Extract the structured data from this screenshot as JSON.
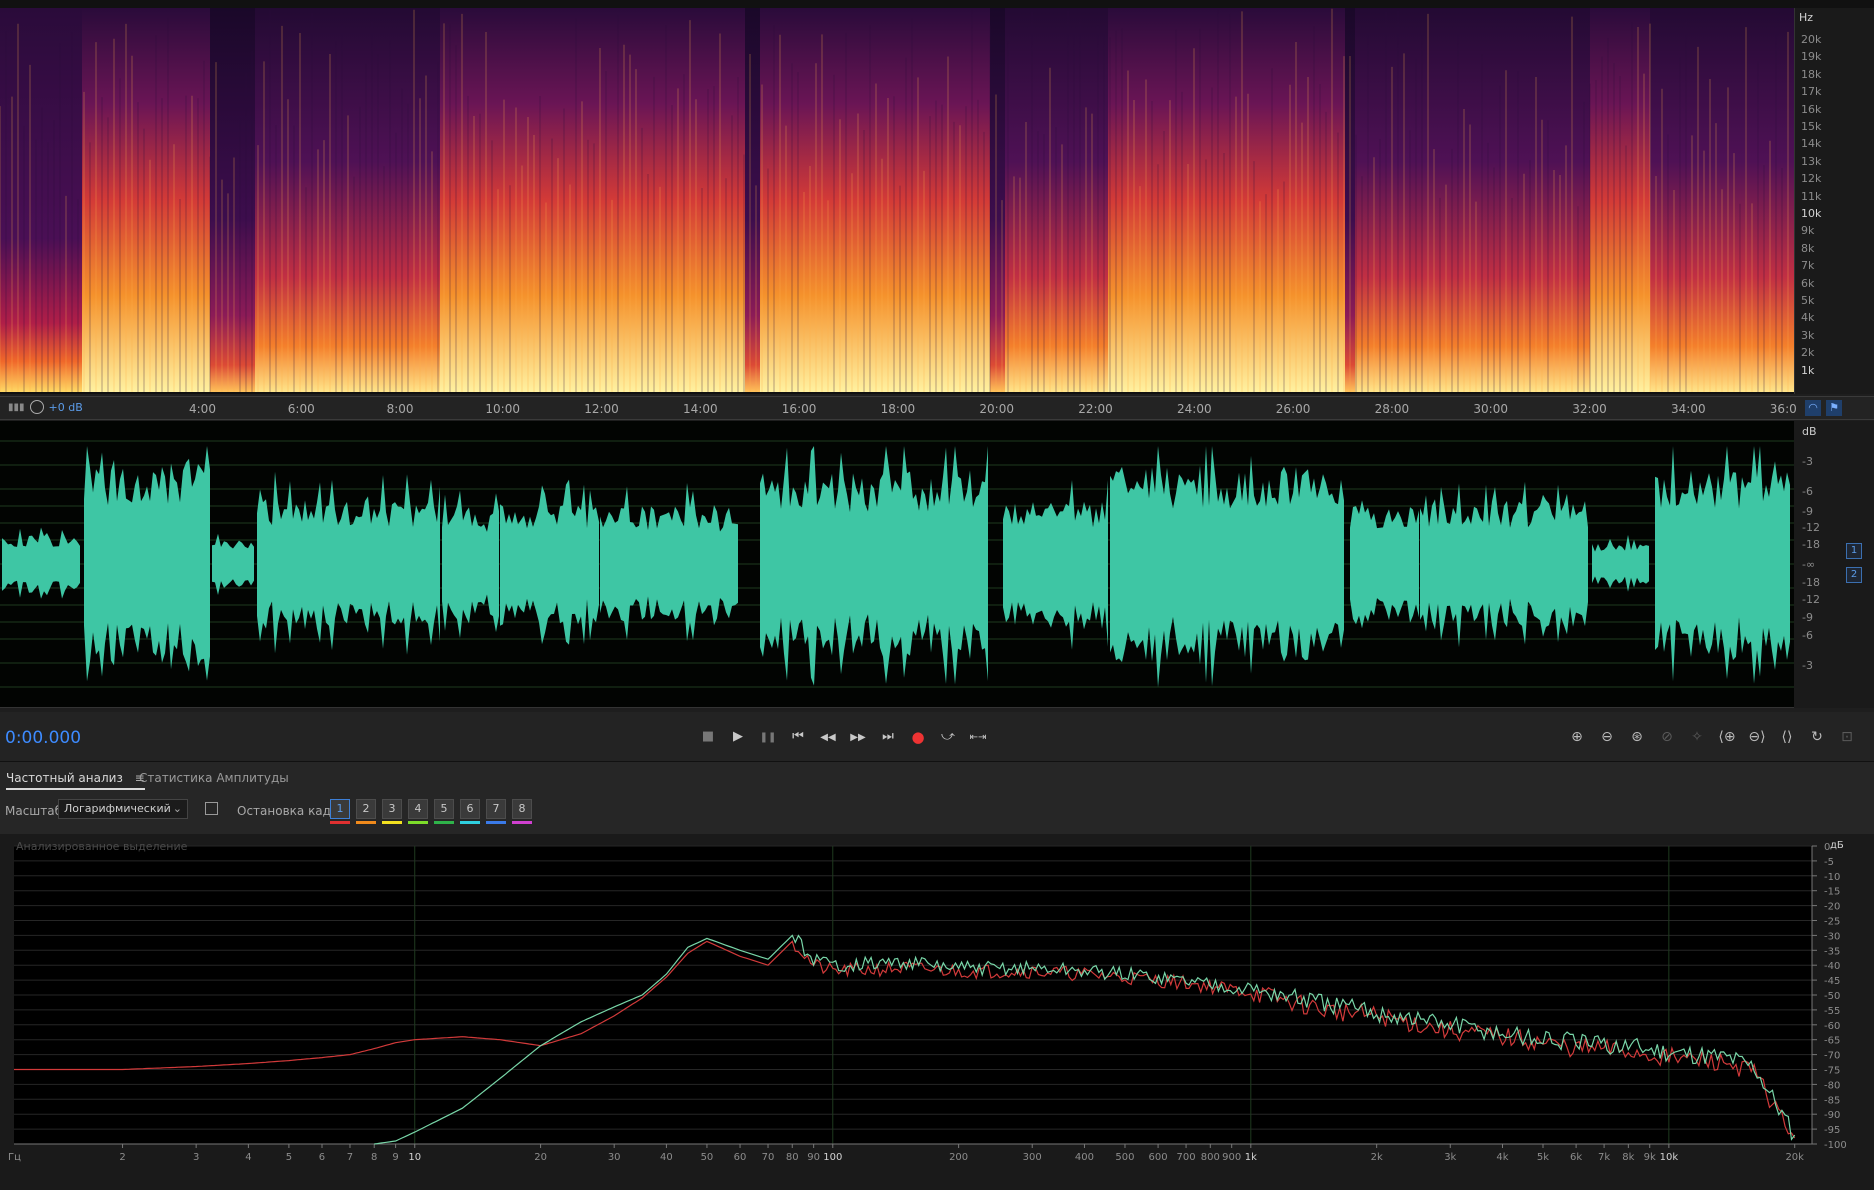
{
  "spectral": {
    "freq_axis_unit": "Hz",
    "freq_ticks": [
      "20k",
      "19k",
      "18k",
      "17k",
      "16k",
      "15k",
      "14k",
      "13k",
      "12k",
      "11k",
      "10k",
      "9k",
      "8k",
      "7k",
      "6k",
      "5k",
      "4k",
      "3k",
      "2k",
      "1k"
    ]
  },
  "timeline": {
    "labels": [
      "4:00",
      "6:00",
      "8:00",
      "10:00",
      "12:00",
      "14:00",
      "16:00",
      "18:00",
      "20:00",
      "22:00",
      "24:00",
      "26:00",
      "28:00",
      "30:00",
      "32:00",
      "34:00",
      "36:0"
    ],
    "gain_hud": "+0 dB"
  },
  "waveform": {
    "color": "#3ec6a4",
    "db_unit": "dB",
    "db_ticks": [
      "-3",
      "-6",
      "-9",
      "-12",
      "-18",
      "-∞",
      "-18",
      "-12",
      "-9",
      "-6",
      "-3"
    ],
    "channels": [
      "1",
      "2"
    ]
  },
  "transport": {
    "time": "0:00.000",
    "buttons": [
      "stop-icon",
      "play-icon",
      "pause-icon",
      "go-to-start-icon",
      "rewind-icon",
      "fast-forward-icon",
      "go-to-end-icon",
      "record-icon",
      "loop-icon",
      "skip-selection-icon"
    ],
    "icons": {
      "stop": "■",
      "play": "▶",
      "pause": "❚❚",
      "start": "⏮",
      "rewind": "◀◀",
      "ffwd": "▶▶",
      "end": "⏭",
      "record": "●",
      "loop": "⤻",
      "skip": "⇤⇥"
    }
  },
  "analysis": {
    "tab_frequency": "Частотный анализ",
    "tab_amplitude": "Статистика Амплитуды",
    "scale_label": "Масштаб:",
    "scale_value": "Логарифмический",
    "hold_label": "Остановка кадра:",
    "hold_buttons": [
      "1",
      "2",
      "3",
      "4",
      "5",
      "6",
      "7",
      "8"
    ],
    "hold_colors": [
      "#e03030",
      "#f08a1c",
      "#f2e020",
      "#7ddc2a",
      "#2fb34a",
      "#2fd0e0",
      "#3a7ae8",
      "#d040d0"
    ],
    "graph_title": "Анализированное выделение",
    "x_axis_unit": "Гц",
    "y_axis_unit": "дБ",
    "x_ticks": [
      "2",
      "3",
      "4",
      "5",
      "6",
      "7",
      "8",
      "9",
      "10",
      "20",
      "30",
      "40",
      "50",
      "60",
      "70",
      "80",
      "90",
      "100",
      "200",
      "300",
      "400",
      "500",
      "600",
      "700",
      "800",
      "900",
      "1k",
      "2k",
      "3k",
      "4k",
      "5k",
      "6k",
      "7k",
      "8k",
      "9k",
      "10k",
      "20k"
    ],
    "y_ticks": [
      "0",
      "-5",
      "-10",
      "-15",
      "-20",
      "-25",
      "-30",
      "-35",
      "-40",
      "-45",
      "-50",
      "-55",
      "-60",
      "-65",
      "-70",
      "-75",
      "-80",
      "-85",
      "-90",
      "-95",
      "-100"
    ]
  },
  "chart_data": {
    "type": "line",
    "title": "",
    "xlabel": "Гц",
    "ylabel": "дБ",
    "xscale": "log",
    "xlim": [
      1.1,
      22000
    ],
    "ylim": [
      -100,
      0
    ],
    "grid": true,
    "series": [
      {
        "color": "#d23a3a",
        "x": [
          1.1,
          2,
          3,
          4,
          5,
          6,
          7,
          8,
          9,
          10,
          13,
          16,
          20,
          25,
          30,
          35,
          40,
          45,
          50,
          60,
          70,
          80,
          90,
          100,
          150,
          200,
          300,
          400,
          500,
          700,
          1000,
          1500,
          2000,
          3000,
          4000,
          5000,
          6000,
          7000,
          8000,
          10000,
          12000,
          14000,
          16000,
          18000,
          20000
        ],
        "y": [
          -75,
          -75,
          -74,
          -73,
          -72,
          -71,
          -70,
          -68,
          -66,
          -65,
          -64,
          -65,
          -67,
          -63,
          -57,
          -51,
          -44,
          -36,
          -32,
          -37,
          -40,
          -32,
          -40,
          -42,
          -41,
          -42,
          -42,
          -43,
          -44,
          -46,
          -49,
          -55,
          -57,
          -62,
          -64,
          -66,
          -68,
          -68,
          -69,
          -71,
          -72,
          -73,
          -76,
          -88,
          -98
        ]
      },
      {
        "color": "#78d6a8",
        "x": [
          8,
          9,
          10,
          13,
          16,
          20,
          25,
          30,
          35,
          40,
          45,
          50,
          60,
          70,
          80,
          90,
          100,
          150,
          200,
          300,
          400,
          500,
          700,
          1000,
          1500,
          2000,
          3000,
          4000,
          5000,
          6000,
          7000,
          8000,
          10000,
          12000,
          14000,
          16000,
          18000,
          20000
        ],
        "y": [
          -100,
          -99,
          -96,
          -88,
          -78,
          -67,
          -59,
          -54,
          -50,
          -43,
          -34,
          -31,
          -35,
          -38,
          -30,
          -38,
          -40,
          -39,
          -41,
          -41,
          -42,
          -43,
          -45,
          -48,
          -53,
          -56,
          -60,
          -63,
          -65,
          -66,
          -67,
          -67,
          -69,
          -70,
          -71,
          -74,
          -86,
          -97
        ]
      }
    ]
  }
}
